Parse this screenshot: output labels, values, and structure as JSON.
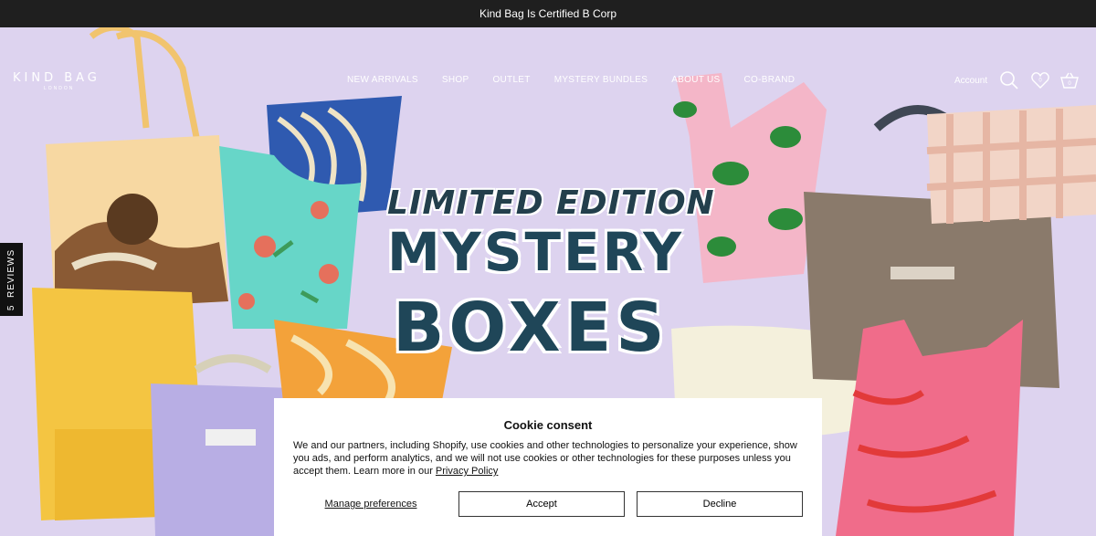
{
  "announcement": "Kind Bag Is Certified B Corp",
  "logo": {
    "line1": "KIND BAG",
    "line2": "LONDON"
  },
  "nav": [
    "NEW ARRIVALS",
    "SHOP",
    "OUTLET",
    "MYSTERY BUNDLES",
    "ABOUT US",
    "CO-BRAND"
  ],
  "header": {
    "account": "Account",
    "wishlist_count": "0",
    "cart_count": "0"
  },
  "reviews_tab": {
    "count": "5",
    "label": "REVIEWS"
  },
  "hero": {
    "line1": "LIMITED EDITION",
    "line2": "MYSTERY",
    "line3": "BOXES"
  },
  "cookie": {
    "title": "Cookie consent",
    "body": "We and our partners, including Shopify, use cookies and other technologies to personalize your experience, show you ads, and perform analytics, and we will not use cookies or other technologies for these purposes unless you accept them. Learn more in our ",
    "link": "Privacy Policy",
    "manage": "Manage preferences",
    "accept": "Accept",
    "decline": "Decline"
  },
  "colors": {
    "bg": "#ddd3ef",
    "headline": "#1f4658",
    "bar": "#1f1f1f"
  }
}
